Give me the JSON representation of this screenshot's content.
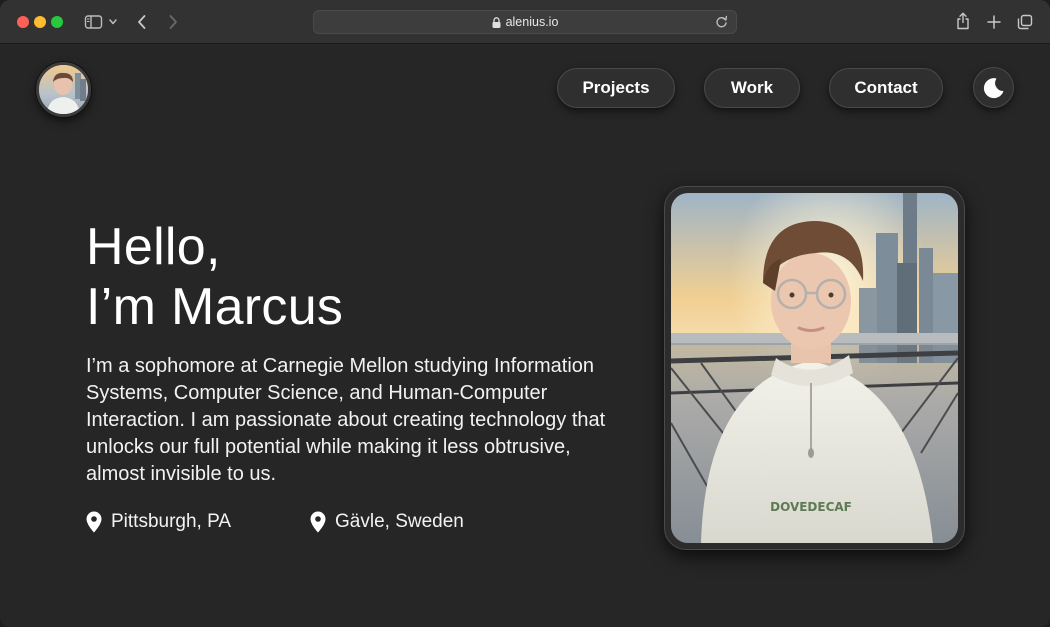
{
  "browser": {
    "url": "alenius.io",
    "icons": {
      "sidebar": "sidebar-icon",
      "back": "chevron-left-icon",
      "forward": "chevron-right-icon",
      "lock": "lock-icon",
      "reload": "reload-icon",
      "share": "share-icon",
      "new_tab": "plus-icon",
      "tabs": "tabs-overview-icon"
    }
  },
  "nav": {
    "items": [
      {
        "label": "Projects"
      },
      {
        "label": "Work"
      },
      {
        "label": "Contact"
      }
    ],
    "theme_toggle_icon": "moon-icon"
  },
  "hero": {
    "greeting": "Hello,",
    "name_line": "I’m Marcus",
    "bio": "I’m a sophomore at Carnegie Mellon studying Information Systems, Computer Science, and Human-Computer Interaction. I am passionate about creating technology that unlocks our full potential while making it less obtrusive, almost invisible to us.",
    "locations": [
      {
        "label": "Pittsburgh, PA",
        "icon": "map-pin-icon"
      },
      {
        "label": "Gävle, Sweden",
        "icon": "map-pin-icon"
      }
    ]
  },
  "colors": {
    "background": "#262626",
    "button_bg": "#2f2f2f",
    "button_border": "#4a4a4a",
    "text": "#ffffff"
  }
}
